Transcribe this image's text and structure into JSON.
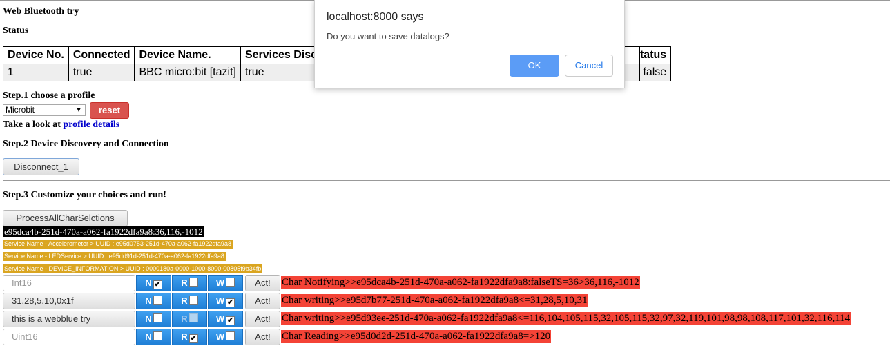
{
  "page": {
    "title": "Web Bluetooth try",
    "status_heading": "Status",
    "step1": "Step.1 choose a profile",
    "profile_select": "Microbit",
    "reset_label": "reset",
    "look_prefix": "Take a look at",
    "look_link": "profile details",
    "step2": "Step.2 Device Discovery and Connection",
    "disconnect_label": "Disconnect_1",
    "step3": "Step.3 Customize your choices and run!",
    "process_label": "ProcessAllCharSelctions",
    "notify_line": "e95dca4b-251d-470a-a062-fa1922dfa9a8:36,116,-1012"
  },
  "status_table": {
    "headers": [
      "Device No.",
      "Connected",
      "Device Name.",
      "Services Disc",
      "tatus"
    ],
    "row": [
      "1",
      "true",
      "BBC micro:bit [tazit]",
      "true",
      "false"
    ]
  },
  "services": [
    "Service Name - Accelerometer > UUID : e95d0753-251d-470a-a062-fa1922dfa9a8",
    "Service Name - LEDService > UUID : e95dd91d-251d-470a-a062-fa1922dfa9a8",
    "Service Name - DEVICE_INFORMATION > UUID : 0000180a-0000-1000-8000-00805f9b34fb"
  ],
  "chars": [
    {
      "value": "Int16",
      "n": "N",
      "r": "R",
      "w": "W",
      "act": "Act!",
      "msg": "Char Notifying>>e95dca4b-251d-470a-a062-fa1922dfa9a8:falseTS=36>36,116,-1012"
    },
    {
      "value": "31,28,5,10,0x1f",
      "n": "N",
      "r": "R",
      "w": "W",
      "act": "Act!",
      "msg": "Char writing>>e95d7b77-251d-470a-a062-fa1922dfa9a8<=31,28,5,10,31"
    },
    {
      "value": "this is a webblue try",
      "n": "N",
      "r": "R",
      "w": "W",
      "act": "Act!",
      "msg": "Char writing>>e95d93ee-251d-470a-a062-fa1922dfa9a8<=116,104,105,115,32,105,115,32,97,32,119,101,98,98,108,117,101,32,116,114"
    },
    {
      "value": "Uint16",
      "n": "N",
      "r": "R",
      "w": "W",
      "act": "Act!",
      "msg": "Char Reading>>e95d0d2d-251d-470a-a062-fa1922dfa9a8=>120"
    }
  ],
  "dialog": {
    "title": "localhost:8000 says",
    "message": "Do you want to save datalogs?",
    "ok": "OK",
    "cancel": "Cancel"
  }
}
